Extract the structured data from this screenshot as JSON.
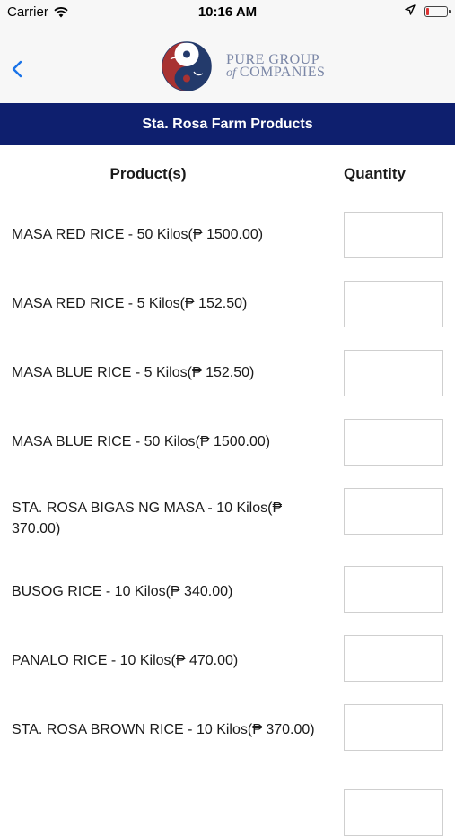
{
  "status_bar": {
    "carrier": "Carrier",
    "time": "10:16 AM"
  },
  "header": {
    "logo_line1": "Pure Group",
    "logo_line2": "of",
    "logo_line3": "Companies"
  },
  "title": "Sta. Rosa Farm Products",
  "columns": {
    "product": "Product(s)",
    "quantity": "Quantity"
  },
  "products": [
    {
      "name": "MASA RED RICE - 50 Kilos(₱ 1500.00)",
      "quantity": ""
    },
    {
      "name": "MASA RED RICE - 5 Kilos(₱ 152.50)",
      "quantity": ""
    },
    {
      "name": "MASA BLUE RICE - 5 Kilos(₱ 152.50)",
      "quantity": ""
    },
    {
      "name": "MASA BLUE RICE - 50 Kilos(₱ 1500.00)",
      "quantity": ""
    },
    {
      "name": "STA. ROSA BIGAS NG MASA - 10 Kilos(₱ 370.00)",
      "quantity": ""
    },
    {
      "name": "BUSOG RICE - 10 Kilos(₱ 340.00)",
      "quantity": ""
    },
    {
      "name": "PANALO RICE - 10 Kilos(₱ 470.00)",
      "quantity": ""
    },
    {
      "name": "STA. ROSA BROWN RICE - 10 Kilos(₱ 370.00)",
      "quantity": ""
    },
    {
      "name": "",
      "quantity": ""
    }
  ],
  "colors": {
    "title_bar": "#0e1f6e",
    "back_arrow": "#1a73e8",
    "logo_red": "#a83232",
    "logo_blue": "#233a6b"
  },
  "icons": {
    "back": "chevron-left-icon",
    "wifi": "wifi-icon",
    "location": "location-arrow-icon",
    "battery": "battery-icon"
  }
}
